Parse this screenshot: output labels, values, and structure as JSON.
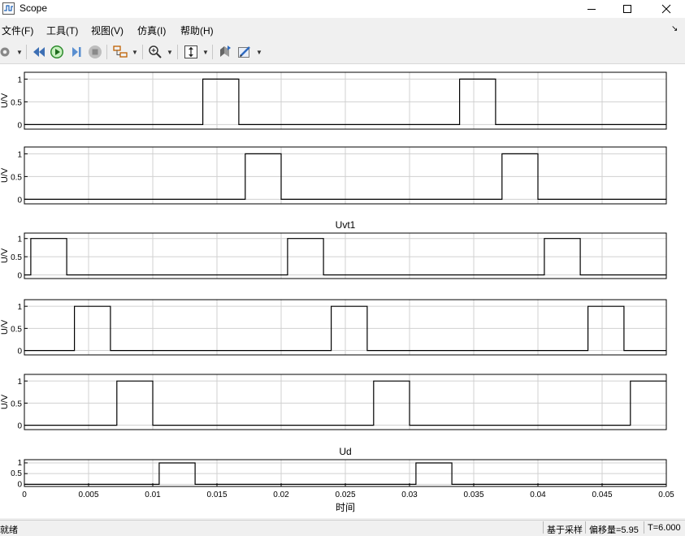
{
  "window": {
    "title": "Scope"
  },
  "menu": [
    "文件(F)",
    "工具(T)",
    "视图(V)",
    "仿真(I)",
    "帮助(H)"
  ],
  "toolbar": {
    "icons": [
      "settings-icon",
      "step-back-icon",
      "run-icon",
      "step-forward-icon",
      "stop-icon",
      "highlight-block-icon",
      "zoom-in-icon",
      "autoscale-icon",
      "restore-layout-icon",
      "style-icon"
    ]
  },
  "status": {
    "ready": "就绪",
    "sample_mode": "基于采样",
    "offset": "偏移量=5.95",
    "time": "T=6.000"
  },
  "colors": {
    "trace": "#000000",
    "grid": "#d0d0d0",
    "background": "#ffffff"
  },
  "chart_data": [
    {
      "type": "line",
      "title": "",
      "ylabel": "U/V",
      "yticks": [
        "0",
        "0.5",
        "1"
      ],
      "ylim": [
        -0.1,
        1.15
      ],
      "xlim": [
        0,
        0.05
      ],
      "grid": true,
      "series": [
        {
          "x": [
            0,
            0.0139,
            0.0139,
            0.0167,
            0.0167,
            0.0339,
            0.0339,
            0.0367,
            0.0367,
            0.05
          ],
          "y": [
            0,
            0,
            1,
            1,
            0,
            0,
            1,
            1,
            0,
            0
          ]
        }
      ]
    },
    {
      "type": "line",
      "title": "",
      "ylabel": "U/V",
      "yticks": [
        "0",
        "0.5",
        "1"
      ],
      "ylim": [
        -0.1,
        1.15
      ],
      "xlim": [
        0,
        0.05
      ],
      "grid": true,
      "series": [
        {
          "x": [
            0,
            0.0172,
            0.0172,
            0.02,
            0.02,
            0.0372,
            0.0372,
            0.04,
            0.04,
            0.05
          ],
          "y": [
            0,
            0,
            1,
            1,
            0,
            0,
            1,
            1,
            0,
            0
          ]
        }
      ]
    },
    {
      "type": "line",
      "title": "Uvt1",
      "ylabel": "U/V",
      "yticks": [
        "0",
        "0.5",
        "1"
      ],
      "ylim": [
        -0.1,
        1.15
      ],
      "xlim": [
        0,
        0.05
      ],
      "grid": true,
      "series": [
        {
          "x": [
            0,
            0.0005,
            0.0005,
            0.0033,
            0.0033,
            0.0205,
            0.0205,
            0.0233,
            0.0233,
            0.0405,
            0.0405,
            0.0433,
            0.0433,
            0.05
          ],
          "y": [
            0,
            0,
            1,
            1,
            0,
            0,
            1,
            1,
            0,
            0,
            1,
            1,
            0,
            0
          ]
        }
      ]
    },
    {
      "type": "line",
      "title": "",
      "ylabel": "U/V",
      "yticks": [
        "0",
        "0.5",
        "1"
      ],
      "ylim": [
        -0.1,
        1.15
      ],
      "xlim": [
        0,
        0.05
      ],
      "grid": true,
      "series": [
        {
          "x": [
            0,
            0.0039,
            0.0039,
            0.0067,
            0.0067,
            0.0239,
            0.0239,
            0.0267,
            0.0267,
            0.0439,
            0.0439,
            0.0467,
            0.0467,
            0.05
          ],
          "y": [
            0,
            0,
            1,
            1,
            0,
            0,
            1,
            1,
            0,
            0,
            1,
            1,
            0,
            0
          ]
        }
      ]
    },
    {
      "type": "line",
      "title": "",
      "ylabel": "U/V",
      "yticks": [
        "0",
        "0.5",
        "1"
      ],
      "ylim": [
        -0.1,
        1.15
      ],
      "xlim": [
        0,
        0.05
      ],
      "grid": true,
      "series": [
        {
          "x": [
            0,
            0.0072,
            0.0072,
            0.01,
            0.01,
            0.0272,
            0.0272,
            0.03,
            0.03,
            0.0472,
            0.0472,
            0.05
          ],
          "y": [
            0,
            0,
            1,
            1,
            0,
            0,
            1,
            1,
            0,
            0,
            1,
            1
          ]
        }
      ]
    },
    {
      "type": "line",
      "title": "Ud",
      "ylabel": "",
      "yticks": [
        "0",
        "0.5",
        "1"
      ],
      "ylim": [
        -0.1,
        1.15
      ],
      "xlim": [
        0,
        0.05
      ],
      "grid": true,
      "xlabel": "时间",
      "xticks": [
        "0",
        "0.005",
        "0.01",
        "0.015",
        "0.02",
        "0.025",
        "0.03",
        "0.035",
        "0.04",
        "0.045",
        "0.05"
      ],
      "series": [
        {
          "x": [
            0,
            0.0105,
            0.0105,
            0.0133,
            0.0133,
            0.0305,
            0.0305,
            0.0333,
            0.0333,
            0.05
          ],
          "y": [
            0,
            0,
            1,
            1,
            0,
            0,
            1,
            1,
            0,
            0
          ]
        }
      ]
    }
  ]
}
